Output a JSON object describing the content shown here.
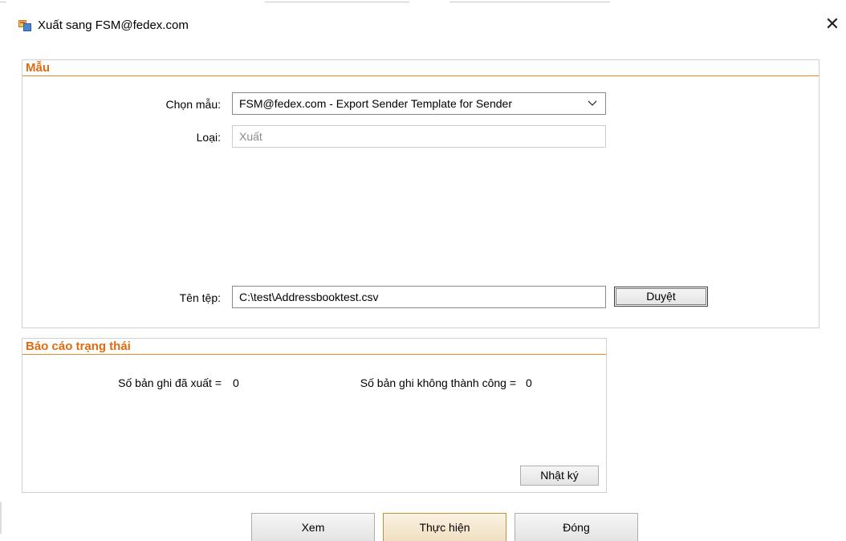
{
  "window": {
    "title": "Xuất sang FSM@fedex.com",
    "close_glyph": "✕",
    "icon": "app-window-icon"
  },
  "template_group": {
    "title": "Mẫu",
    "choose_template_label": "Chọn mẫu:",
    "choose_template_value": "FSM@fedex.com - Export Sender Template for Sender",
    "type_label": "Loại:",
    "type_value": "Xuất",
    "file_name_label": "Tên tệp:",
    "file_name_value": "C:\\test\\Addressbooktest.csv",
    "browse_label": "Duyệt"
  },
  "status_group": {
    "title": "Báo cáo trạng thái",
    "exported_label": "Số bản ghi đã xuất =",
    "exported_value": "0",
    "failed_label": "Số bản ghi không thành công =",
    "failed_value": "0",
    "log_label": "Nhật ký"
  },
  "footer": {
    "view_label": "Xem",
    "execute_label": "Thực hiện",
    "close_label": "Đóng"
  },
  "colors": {
    "group_title": "#e06a10",
    "group_rule": "#e38a2a"
  }
}
